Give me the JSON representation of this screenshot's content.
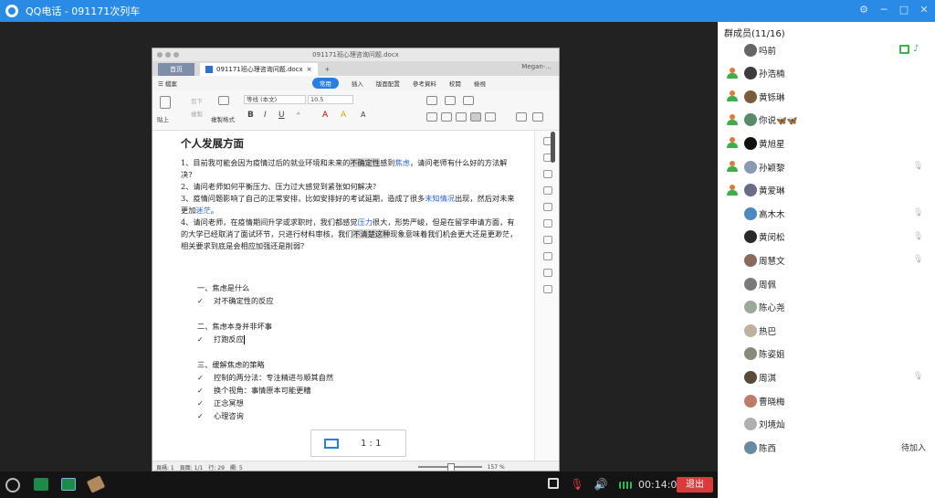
{
  "app": {
    "title": "QQ电话 - 091171次列车"
  },
  "doc_window": {
    "title": "091171班心理咨询问题.docx",
    "tab_home": "首页",
    "tab_doc": "091171班心理咨询问题.docx",
    "tab_close": "×",
    "tab_add": "+",
    "user": "Megan-...",
    "menu": [
      {
        "label": "☰  檔案"
      },
      {
        "label": "常用"
      },
      {
        "label": "插入"
      },
      {
        "label": "版面配置"
      },
      {
        "label": "參考資料"
      },
      {
        "label": "校閱"
      },
      {
        "label": "檢視"
      }
    ],
    "ribbon": {
      "paste": "貼上",
      "cut": "剪下",
      "copy": "複製",
      "format_painter": "複製格式",
      "font_name": "等线 (本文)",
      "font_size": "10.5"
    }
  },
  "document": {
    "heading": "个人发展方面",
    "q1_a": "1、目前我可能会因为疫情过后的就业环境和未来的",
    "q1_hl": "不确定性",
    "q1_b": "感到",
    "q1_blue": "焦虑",
    "q1_c": "，请问老师有什么好的方法解决？",
    "q2": "2、请问老师如何平衡压力、压力过大感觉到紧张如何解决？",
    "q3_a": "3、疫情问题影响了自己的正常安排，比如安排好的考试延期，造成了很多",
    "q3_blue1": "未知情况",
    "q3_b": "出现，然后对未来更加",
    "q3_blue2": "迷茫",
    "q3_c": "。",
    "q4_a": "4、请问老师，在疫情期间升学或求职时，我们都感觉",
    "q4_blue": "压力",
    "q4_b": "很大，形势严峻，但是在留学申请方面，有的大学已经取消了面试环节，只进行材料审核，我们",
    "q4_hl": "不清楚这种",
    "q4_c": "现象意味着我们机会更大还是更渺茫，相关要求到底是会相应加强还是削弱？",
    "outline": [
      {
        "title": "一、焦虑是什么",
        "items": [
          "对不确定性的反应"
        ]
      },
      {
        "title": "二、焦虑本身并非坏事",
        "items": [
          "打跑反应"
        ]
      },
      {
        "title": "三、缓解焦虑的策略",
        "items": [
          "控制的两分法：专注精进与顺其自然",
          "换个视角：事情原本可能更糟",
          "正念冥想",
          "心理咨询"
        ]
      }
    ],
    "check": "✓"
  },
  "status_bar": {
    "page": "頁碼: 1",
    "pages": "頁面: 1/1",
    "line": "行: 29",
    "col": "欄: 5",
    "zoom": "157 %"
  },
  "ratio_label": "1 : 1",
  "call": {
    "time": "00:14:07",
    "hangup": "退出"
  },
  "members": {
    "title": "群成员(11/16)",
    "list": [
      {
        "name": "吗前",
        "host": false,
        "muted": false,
        "sharing": true,
        "color": "#666666"
      },
      {
        "name": "孙浩楠",
        "host": true,
        "muted": false,
        "color": "#3d3d3d"
      },
      {
        "name": "黄铄琳",
        "host": true,
        "muted": false,
        "color": "#7a5c3a"
      },
      {
        "name": "你说🦋🦋",
        "host": true,
        "muted": false,
        "color": "#5a8a6a"
      },
      {
        "name": "黄旭星",
        "host": true,
        "muted": false,
        "color": "#111111"
      },
      {
        "name": "孙颖黎",
        "host": true,
        "muted": true,
        "color": "#8a9ab0"
      },
      {
        "name": "黄爱琳",
        "host": true,
        "muted": false,
        "color": "#6a6a8a"
      },
      {
        "name": "高木木",
        "host": false,
        "muted": true,
        "color": "#4a8ac0"
      },
      {
        "name": "黄闵松",
        "host": false,
        "muted": true,
        "color": "#2a2a2a"
      },
      {
        "name": "周慧文",
        "host": false,
        "muted": true,
        "color": "#8a6a5a"
      },
      {
        "name": "周佩",
        "host": false,
        "muted": false,
        "color": "#7a7a7a"
      },
      {
        "name": "陈心尧",
        "host": false,
        "muted": false,
        "color": "#9aaa9a"
      },
      {
        "name": "热巴",
        "host": false,
        "muted": false,
        "color": "#c0b0a0"
      },
      {
        "name": "陈姿姐",
        "host": false,
        "muted": false,
        "color": "#8a8a7a"
      },
      {
        "name": "周淇",
        "host": false,
        "muted": true,
        "color": "#5a4a3a"
      },
      {
        "name": "曹晓梅",
        "host": false,
        "muted": false,
        "color": "#c07a6a"
      },
      {
        "name": "刘境灿",
        "host": false,
        "muted": false,
        "color": "#b0b0b0"
      },
      {
        "name": "陈西",
        "host": false,
        "muted": false,
        "pending": "待加入",
        "color": "#6a8aa0"
      }
    ]
  }
}
